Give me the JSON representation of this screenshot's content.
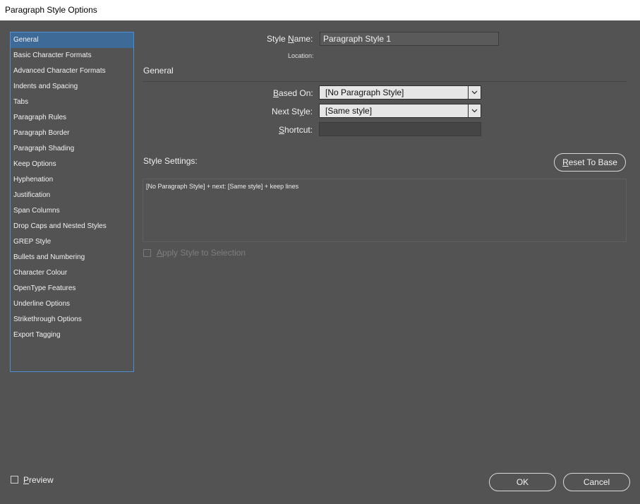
{
  "window": {
    "title": "Paragraph Style Options"
  },
  "sidebar": {
    "items": [
      {
        "label": "General",
        "selected": true
      },
      {
        "label": "Basic Character Formats"
      },
      {
        "label": "Advanced Character Formats"
      },
      {
        "label": "Indents and Spacing"
      },
      {
        "label": "Tabs"
      },
      {
        "label": "Paragraph Rules"
      },
      {
        "label": "Paragraph Border"
      },
      {
        "label": "Paragraph Shading"
      },
      {
        "label": "Keep Options"
      },
      {
        "label": "Hyphenation"
      },
      {
        "label": "Justification"
      },
      {
        "label": "Span Columns"
      },
      {
        "label": "Drop Caps and Nested Styles"
      },
      {
        "label": "GREP Style"
      },
      {
        "label": "Bullets and Numbering"
      },
      {
        "label": "Character Colour"
      },
      {
        "label": "OpenType Features"
      },
      {
        "label": "Underline Options"
      },
      {
        "label": "Strikethrough Options"
      },
      {
        "label": "Export Tagging"
      }
    ]
  },
  "form": {
    "style_name_label_pre": "Style ",
    "style_name_label_u": "N",
    "style_name_label_post": "ame:",
    "style_name_value": "Paragraph Style 1",
    "location_label": "Location:",
    "section_title": "General",
    "based_on_label_u": "B",
    "based_on_label_post": "ased On:",
    "based_on_value": "[No Paragraph Style]",
    "next_style_label_pre": "Next St",
    "next_style_label_u": "y",
    "next_style_label_post": "le:",
    "next_style_value": "[Same style]",
    "shortcut_label_u": "S",
    "shortcut_label_post": "hortcut:",
    "shortcut_value": "",
    "style_settings_label": "Style Settings:",
    "reset_label_u": "R",
    "reset_label_post": "eset To Base",
    "style_settings_text": "[No Paragraph Style] + next: [Same style] + keep lines",
    "apply_label_u": "A",
    "apply_label_post": "pply Style to Selection"
  },
  "footer": {
    "preview_label_u": "P",
    "preview_label_post": "review",
    "ok_label": "OK",
    "cancel_label": "Cancel"
  },
  "colors": {
    "background": "#535353",
    "selection": "#3e6a98",
    "sidebar_border": "#4a8fd6"
  }
}
